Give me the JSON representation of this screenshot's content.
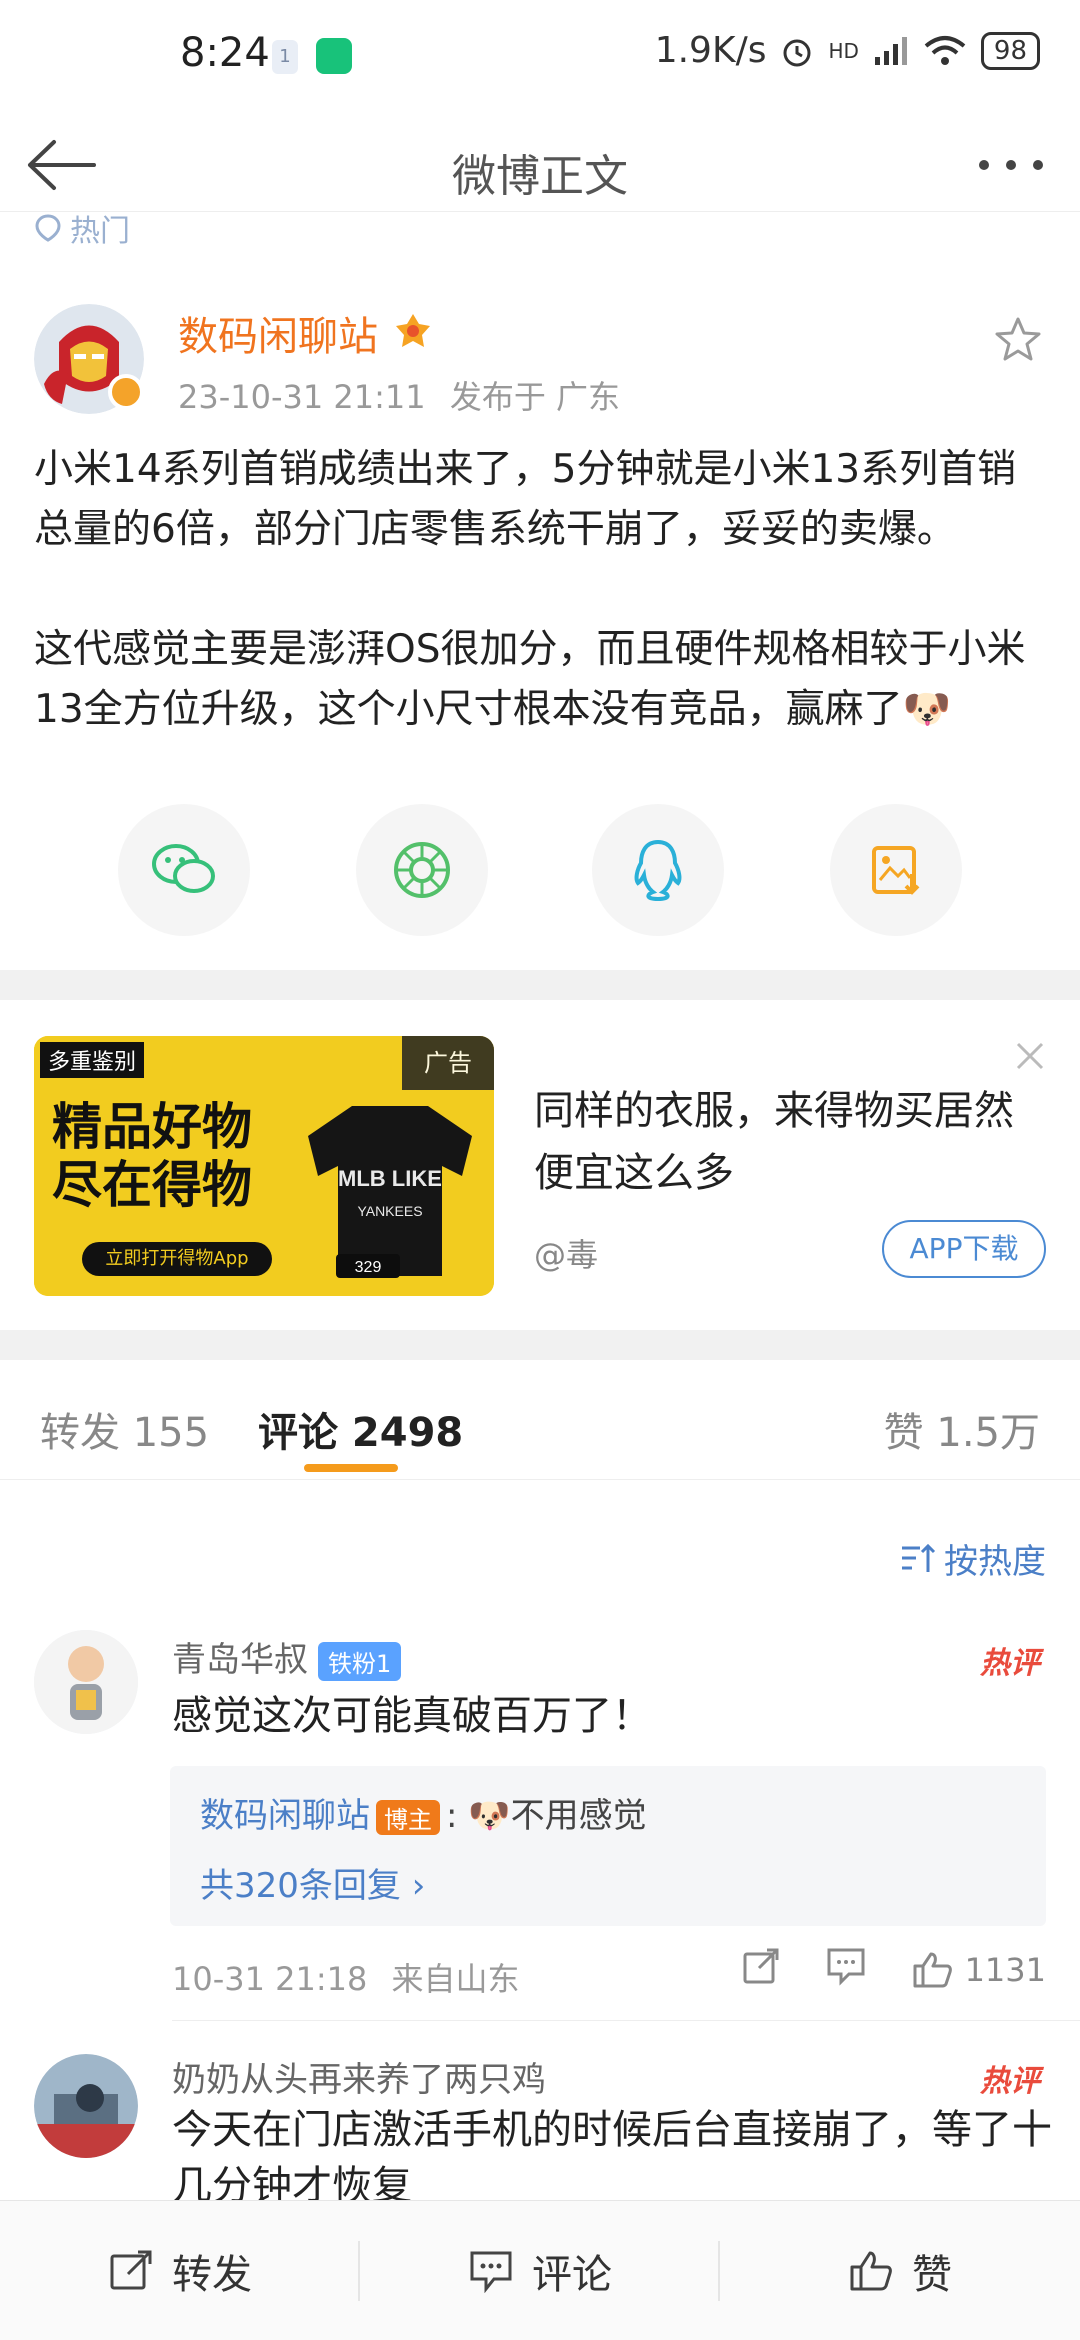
{
  "status": {
    "time": "8:24",
    "notif_mini": "1",
    "net_speed": "1.9K/s",
    "network": "HD",
    "battery": "98"
  },
  "header": {
    "title": "微博正文"
  },
  "post": {
    "hot_tag": "热门",
    "author": "数码闲聊站",
    "date": "23-10-31 21:11",
    "location": "发布于 广东",
    "paragraphs": [
      "小米14系列首销成绩出来了，5分钟就是小米13系列首销总量的6倍，部分门店零售系统干崩了，妥妥的卖爆。",
      "这代感觉主要是澎湃OS很加分，而且硬件规格相较于小米13全方位升级，这个小尺寸根本没有竞品，赢麻了🐶"
    ]
  },
  "share": {
    "icons": [
      "wechat-icon",
      "moments-icon",
      "qq-icon",
      "save-image-icon"
    ]
  },
  "ad": {
    "badge": "广告",
    "headline": "同样的衣服，来得物买居然便宜这么多",
    "source": "@毒",
    "button": "APP下载",
    "image": {
      "tag": "多重鉴别",
      "line1": "精品好物",
      "line2": "尽在得物",
      "cta": "立即打开得物App",
      "shirt_text": "MLB LIKE",
      "shirt_sub": "YANKEES",
      "price": "329"
    }
  },
  "tabs": {
    "repost": "转发 155",
    "comment": "评论 2498",
    "like": "赞 1.5万"
  },
  "sort": "按热度",
  "comments": [
    {
      "name": "青岛华叔",
      "fan_badge": "铁粉1",
      "hot": "热评",
      "text": "感觉这次可能真破百万了！",
      "reply": {
        "author": "数码闲聊站",
        "badge": "博主",
        "content": "🐶不用感觉",
        "count": "共320条回复 ›"
      },
      "time": "10-31 21:18",
      "from": "来自山东",
      "likes": "1131"
    },
    {
      "name": "奶奶从头再来养了两只鸡",
      "hot": "热评",
      "text": "今天在门店激活手机的时候后台直接崩了，等了十几分钟才恢复"
    }
  ],
  "bottom": {
    "repost": "转发",
    "comment": "评论",
    "like": "赞"
  }
}
